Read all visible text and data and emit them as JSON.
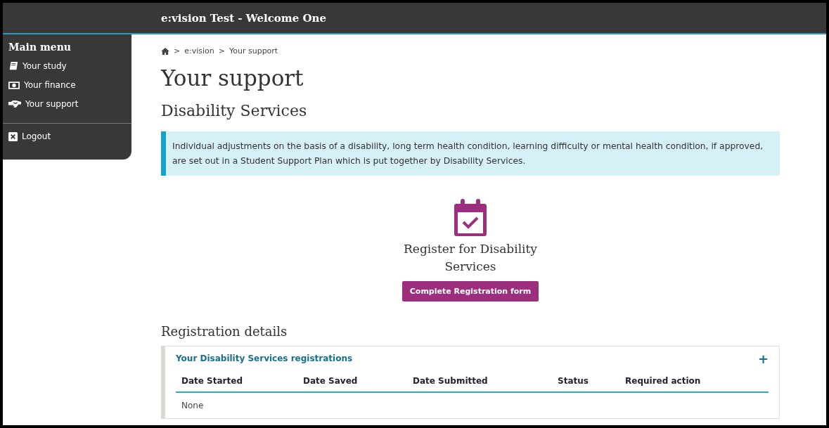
{
  "header": {
    "title": "e:vision Test - Welcome One"
  },
  "sidebar": {
    "title": "Main menu",
    "items": [
      {
        "kind": "book",
        "label": "Your study"
      },
      {
        "kind": "money",
        "label": "Your finance"
      },
      {
        "kind": "handshake",
        "label": "Your support"
      }
    ],
    "footer_items": [
      {
        "kind": "close",
        "label": "Logout"
      }
    ]
  },
  "breadcrumb": [
    {
      "kind": "home"
    },
    {
      "kind": "separator",
      "label": ">"
    },
    {
      "label": "e:vision"
    },
    {
      "kind": "separator",
      "label": ">"
    },
    {
      "label": "Your support"
    }
  ],
  "page_title": "Your support",
  "section_title": "Disability Services",
  "info_box": "Individual adjustments on the basis of a disability, long term health condition, learning difficulty or mental health condition, if approved, are set out in a Student Support Plan which is put together by Disability Services.",
  "register": {
    "title": "Register for Disability Services",
    "button": "Complete Registration form"
  },
  "details": {
    "title": "Registration details",
    "panel_title": "Your Disability Services registrations",
    "expand": "+",
    "columns": [
      "Date Started",
      "Date Saved",
      "Date Submitted",
      "Status",
      "Required action"
    ],
    "empty": "None"
  }
}
